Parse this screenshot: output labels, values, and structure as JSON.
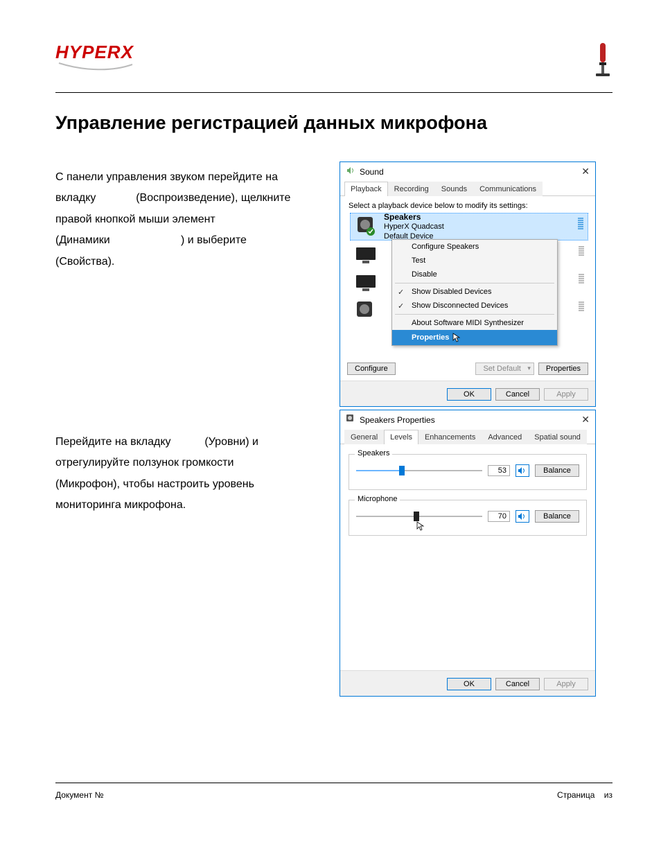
{
  "brand": {
    "logo_text": "HYPERX"
  },
  "heading": "Управление регистрацией данных микрофона",
  "paragraphs": {
    "p1": "С панели управления звуком перейдите на вкладку             (Воспроизведение), щелкните правой кнопкой мыши элемент                              (Динамики                       ) и выберите               (Свойства).",
    "p2": "Перейдите на вкладку           (Уровни) и отрегулируйте ползунок громкости                         (Микрофон), чтобы настроить уровень мониторинга микрофона."
  },
  "win1": {
    "title": "Sound",
    "tabs": [
      "Playback",
      "Recording",
      "Sounds",
      "Communications"
    ],
    "active_tab": 0,
    "subtext": "Select a playback device below to modify its settings:",
    "device": {
      "name": "Speakers",
      "sub": "HyperX Quadcast",
      "status": "Default Device"
    },
    "context": {
      "items": [
        {
          "label": "Configure Speakers"
        },
        {
          "label": "Test"
        },
        {
          "label": "Disable"
        },
        {
          "sep": true
        },
        {
          "label": "Show Disabled Devices",
          "checked": true
        },
        {
          "label": "Show Disconnected Devices",
          "checked": true
        },
        {
          "sep": true
        },
        {
          "label": "About Software MIDI Synthesizer"
        },
        {
          "label": "Properties",
          "selected": true
        }
      ]
    },
    "buttons": {
      "configure": "Configure",
      "set_default": "Set Default",
      "properties": "Properties",
      "ok": "OK",
      "cancel": "Cancel",
      "apply": "Apply"
    }
  },
  "win2": {
    "title": "Speakers Properties",
    "tabs": [
      "General",
      "Levels",
      "Enhancements",
      "Advanced",
      "Spatial sound"
    ],
    "active_tab": 1,
    "groups": {
      "speakers": {
        "label": "Speakers",
        "value": "53",
        "percent": 36,
        "balance": "Balance"
      },
      "microphone": {
        "label": "Microphone",
        "value": "70",
        "percent": 48,
        "balance": "Balance"
      }
    },
    "buttons": {
      "ok": "OK",
      "cancel": "Cancel",
      "apply": "Apply"
    }
  },
  "footer": {
    "left": "Документ №",
    "right_a": "Страница",
    "right_b": "из"
  }
}
